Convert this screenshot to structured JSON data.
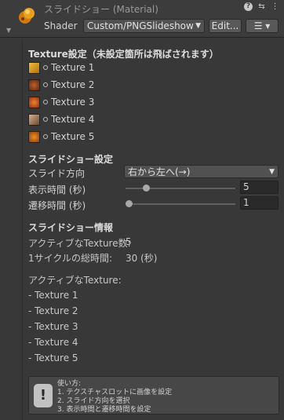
{
  "header": {
    "title": "スライドショー (Material)",
    "shader_label": "Shader",
    "shader_value": "Custom/PNGSlideshow",
    "edit_label": "Edit...",
    "menu_icon": "list-icon"
  },
  "textures_section": {
    "title": "Texture設定（未設定箇所は飛ばされます）",
    "items": [
      {
        "label": "Texture 1",
        "color": "#c8a030"
      },
      {
        "label": "Texture 2",
        "color": "#a0502a"
      },
      {
        "label": "Texture 3",
        "color": "#d06a20"
      },
      {
        "label": "Texture 4",
        "color": "#a87a5a"
      },
      {
        "label": "Texture 5",
        "color": "#d0701a"
      }
    ]
  },
  "slideshow_settings": {
    "title": "スライドショー設定",
    "direction_label": "スライド方向",
    "direction_value": "右から左へ(→)",
    "display_time_label": "表示時間 (秒)",
    "display_time_value": "5",
    "display_time_level": 0.17,
    "transition_time_label": "遷移時間 (秒)",
    "transition_time_value": "1",
    "transition_time_level": 0.0
  },
  "slideshow_info": {
    "title": "スライドショー情報",
    "active_count_label": "アクティブなTexture数:",
    "active_count_value": "5",
    "cycle_label": "1サイクルの総時間:",
    "cycle_value": "30 (秒)",
    "active_list_label": "アクティブなTexture:",
    "active_list": [
      "- Texture 1",
      "- Texture 2",
      "- Texture 3",
      "- Texture 4",
      "- Texture 5"
    ]
  },
  "help": {
    "title": "使い方:",
    "lines": [
      "1. テクスチャスロットに画像を設定",
      "2. スライド方向を選択",
      "3. 表示時間と遷移時間を設定"
    ]
  }
}
